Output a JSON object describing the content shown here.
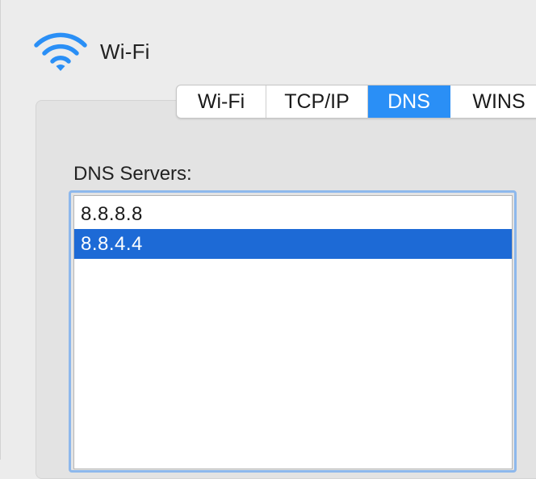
{
  "header": {
    "title": "Wi-Fi",
    "icon": "wifi-icon",
    "icon_color": "#2a8ff6"
  },
  "tabs": [
    {
      "label": "Wi-Fi",
      "active": false
    },
    {
      "label": "TCP/IP",
      "active": false
    },
    {
      "label": "DNS",
      "active": true
    },
    {
      "label": "WINS",
      "active": false
    }
  ],
  "dns": {
    "label": "DNS Servers:",
    "servers": [
      {
        "address": "8.8.8.8",
        "selected": false
      },
      {
        "address": "8.8.4.4",
        "selected": true
      }
    ]
  },
  "colors": {
    "accent": "#2a8ff6",
    "selection": "#1d6ad6",
    "focus_ring": "#8db8ec"
  }
}
